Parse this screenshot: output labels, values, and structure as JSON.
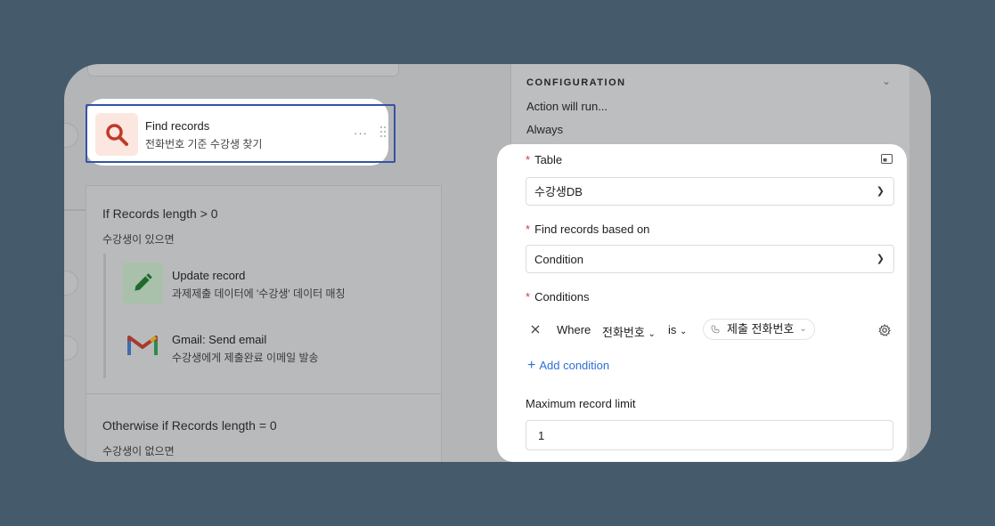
{
  "find_records": {
    "title": "Find records",
    "subtitle": "전화번호 기준 수강생 찾기",
    "more": "···"
  },
  "branch1": {
    "title": "If Records length > 0",
    "subtitle": "수강생이 있으면",
    "steps": [
      {
        "title": "Update record",
        "subtitle": "과제제출 데이터에 '수강생' 데이터 매칭",
        "icon": "pencil-icon"
      },
      {
        "title": "Gmail: Send email",
        "subtitle": "수강생에게 제출완료 이메일 발송",
        "icon": "gmail-icon"
      }
    ]
  },
  "branch2": {
    "title": "Otherwise if Records length = 0",
    "subtitle": "수강생이 없으면"
  },
  "config": {
    "heading": "CONFIGURATION",
    "action_label": "Action will run...",
    "action_value": "Always",
    "table_label": "Table",
    "table_value": "수강생DB",
    "find_label": "Find records based on",
    "find_value": "Condition",
    "conditions_label": "Conditions",
    "condition": {
      "where": "Where",
      "field": "전화번호",
      "operator": "is",
      "value": "제출 전화번호"
    },
    "add_condition": "Add condition",
    "limit_label": "Maximum record limit",
    "limit_value": "1"
  },
  "colors": {
    "background": "#455a6a",
    "highlight_border": "#3453a6",
    "link": "#2f6fd6",
    "required": "#d23b3b",
    "search_icon": "#c0392b"
  }
}
